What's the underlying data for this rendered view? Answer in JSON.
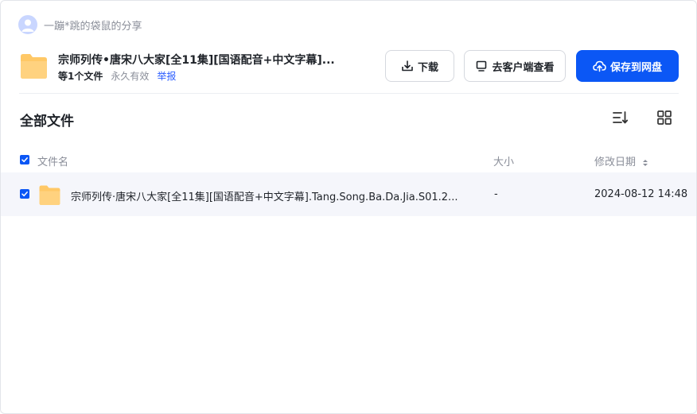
{
  "sharer": {
    "name": "一蹦*跳的袋鼠的分享"
  },
  "share": {
    "title": "宗师列传•唐宋八大家[全11集][国语配音+中文字幕]...",
    "file_count": "等1个文件",
    "validity": "永久有效",
    "report_link": "举报"
  },
  "actions": {
    "download_label": "下载",
    "client_label": "去客户端查看",
    "save_label": "保存到网盘"
  },
  "section": {
    "title": "全部文件"
  },
  "table": {
    "columns": {
      "name": "文件名",
      "size": "大小",
      "modified": "修改日期"
    },
    "rows": [
      {
        "name": "宗师列传·唐宋八大家[全11集][国语配音+中文字幕].Tang.Song.Ba.Da.Jia.S01.2...",
        "size": "-",
        "modified": "2024-08-12 14:48",
        "checked": true
      }
    ]
  },
  "colors": {
    "accent": "#0b57f5",
    "folder": "#ffc866",
    "row_bg": "#f5f6fb"
  }
}
